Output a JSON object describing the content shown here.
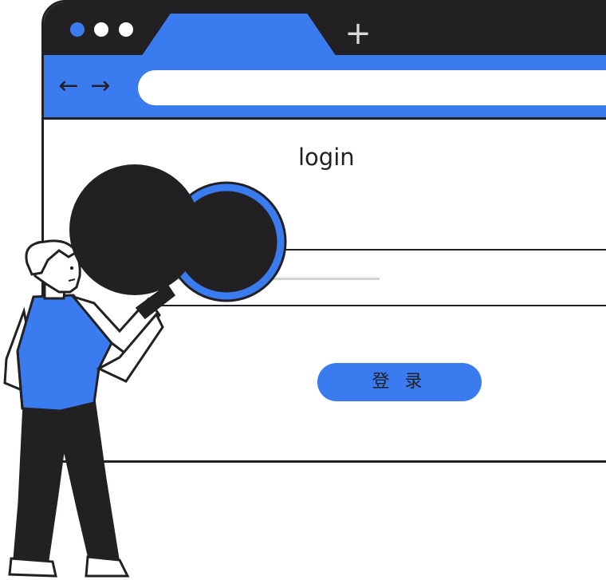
{
  "browser": {
    "new_tab_icon": "plus-icon",
    "nav": {
      "back_icon": "arrow-left-icon",
      "forward_icon": "arrow-right-icon"
    },
    "address_value": ""
  },
  "page": {
    "title": "login",
    "login_button_label": "登 录"
  },
  "colors": {
    "accent": "#3a7cf0",
    "dark": "#222023",
    "light_line": "#d3d3d3"
  },
  "illustration": {
    "subject": "person-holding-magnifier-icon"
  }
}
